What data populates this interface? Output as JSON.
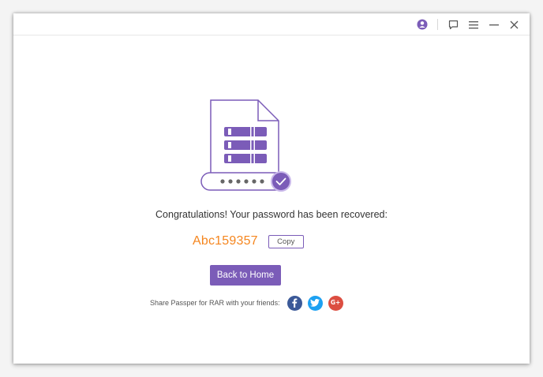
{
  "titlebar": {
    "icons": [
      "account-icon",
      "feedback-icon",
      "menu-icon",
      "minimize-icon",
      "close-icon"
    ]
  },
  "main": {
    "congrats_text": "Congratulations! Your password has been recovered:",
    "password": "Abc159357",
    "copy_label": "Copy",
    "back_home_label": "Back to Home",
    "share_text": "Share Passper for RAR with your friends:",
    "social": [
      "facebook-icon",
      "twitter-icon",
      "google-plus-icon"
    ],
    "google_plus_glyph": "G+"
  },
  "colors": {
    "accent": "#7b5cb8",
    "password": "#f5861f",
    "facebook": "#3b5998",
    "twitter": "#1da1f2",
    "google_plus": "#dc4e41"
  }
}
